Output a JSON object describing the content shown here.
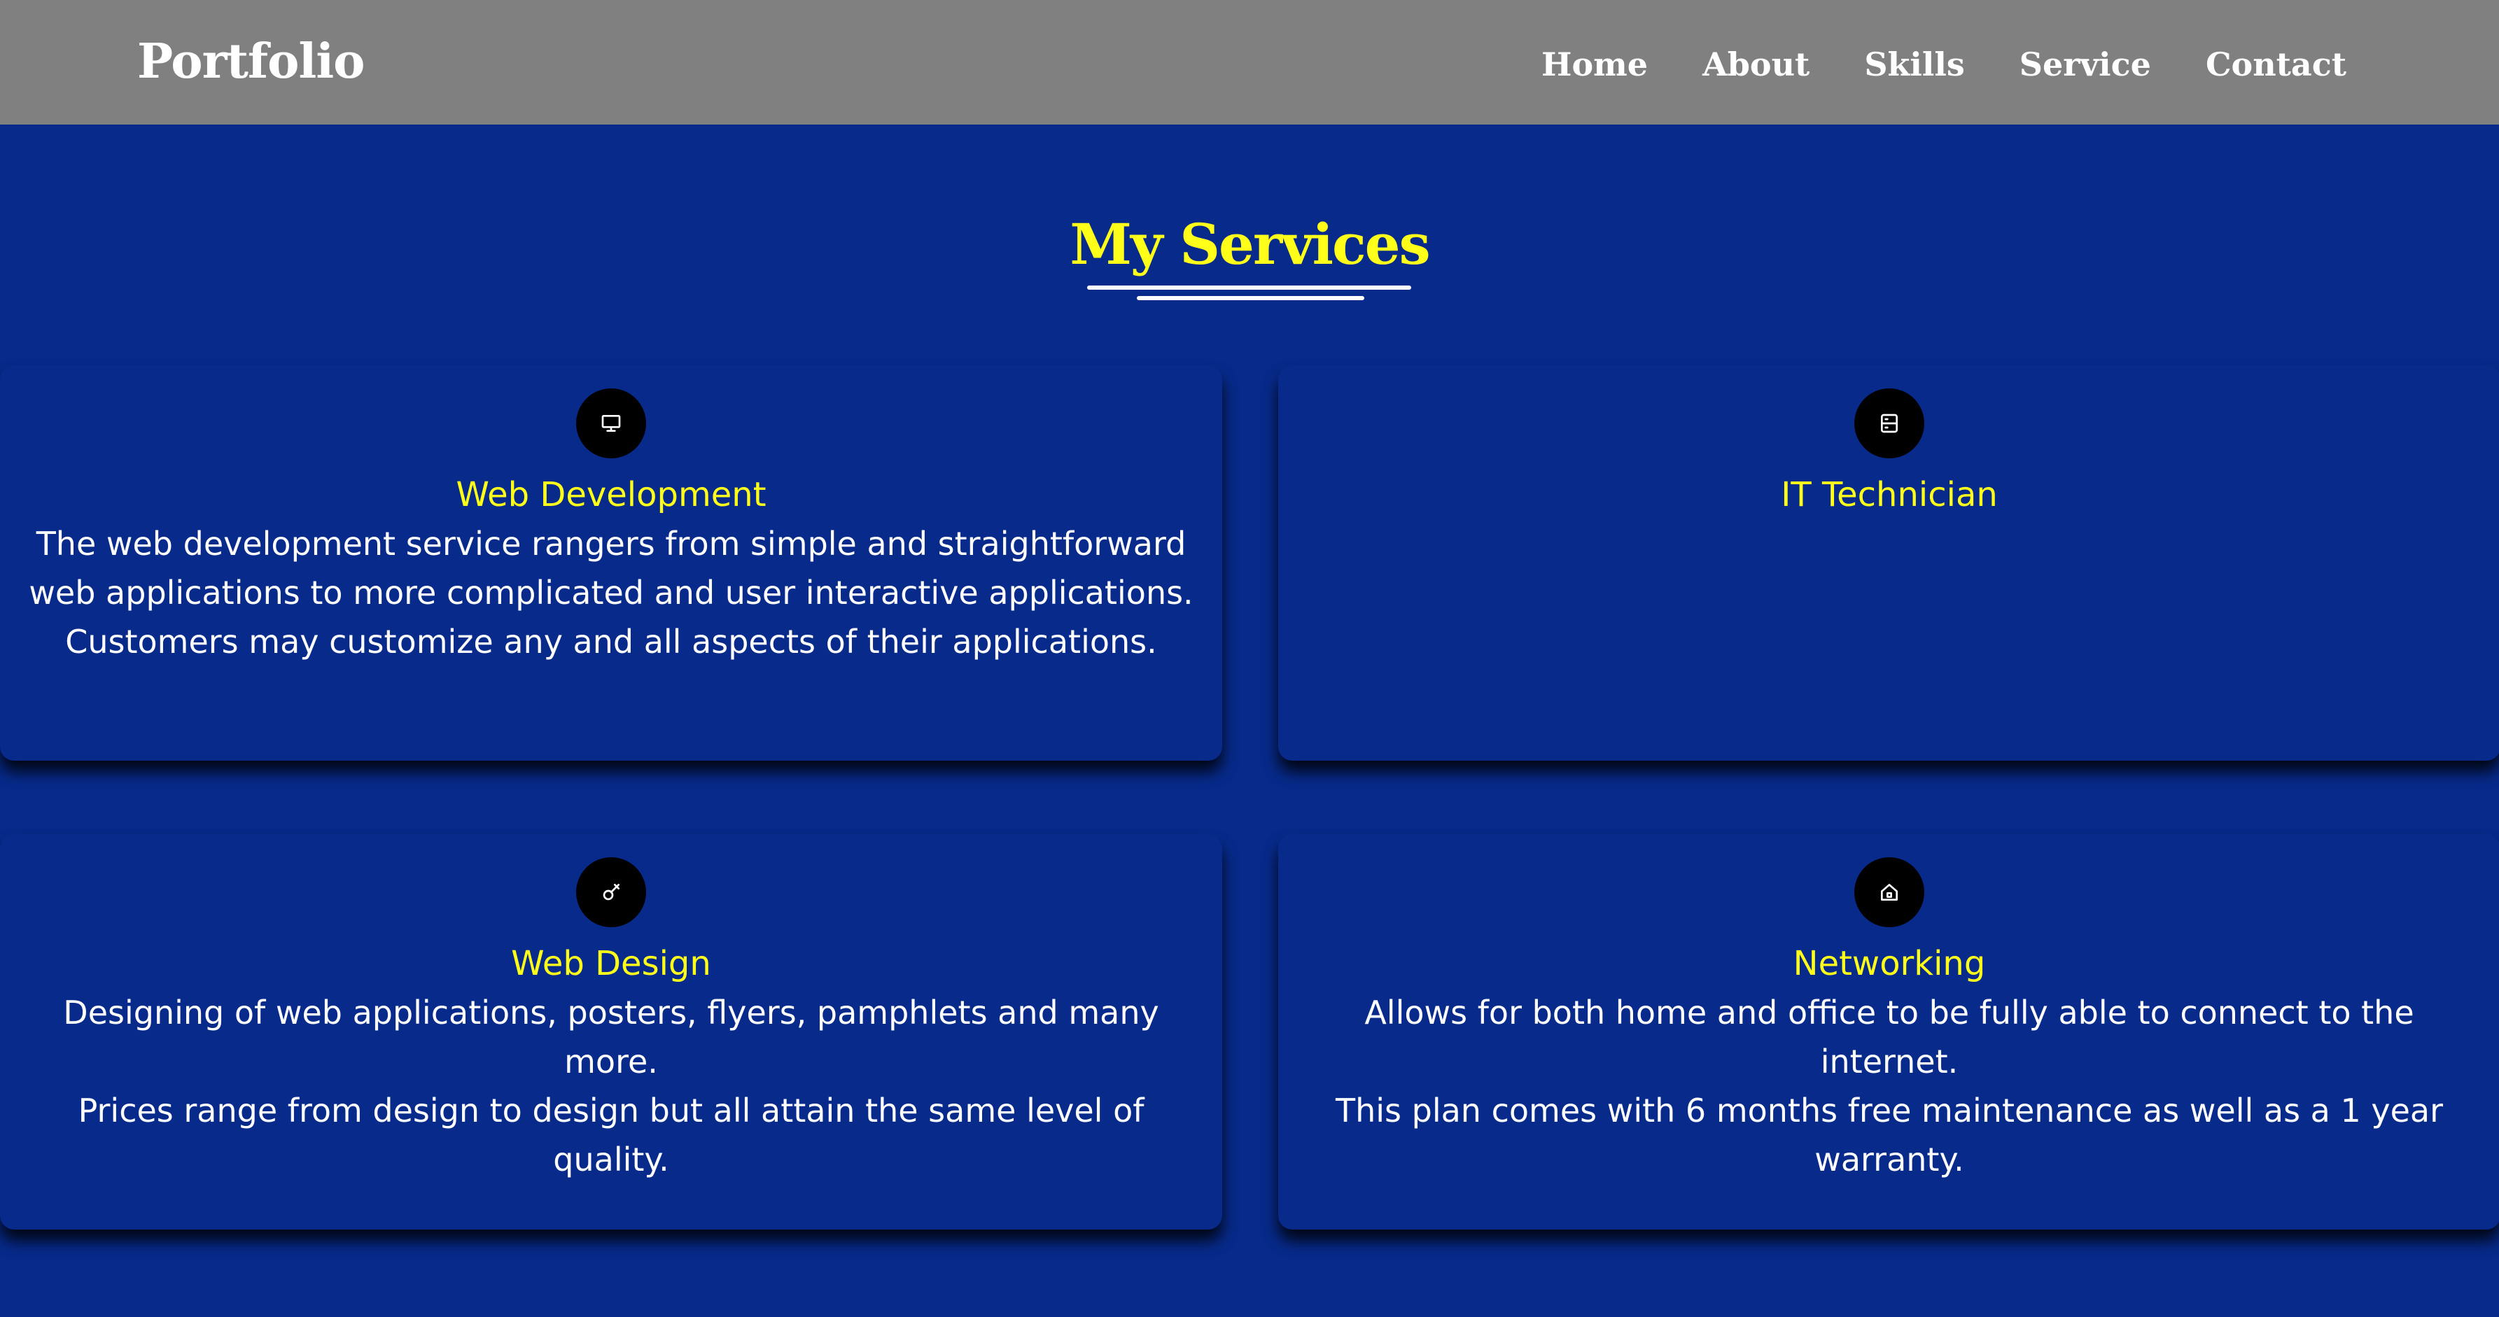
{
  "navbar": {
    "brand": "Portfolio",
    "links": [
      "Home",
      "About",
      "Skills",
      "Service",
      "Contact"
    ]
  },
  "section": {
    "title": "My Services"
  },
  "services": [
    {
      "icon": "monitor-icon",
      "title": "Web Development",
      "paragraphs": [
        "The web development service rangers from simple and straightforward web applications to more complicated and user interactive applications.",
        "Customers may customize any and all aspects of their applications."
      ]
    },
    {
      "icon": "server-icon",
      "title": "IT Technician",
      "paragraphs": []
    },
    {
      "icon": "paint-brush-icon",
      "title": "Web Design",
      "paragraphs": [
        "Designing of web applications, posters, flyers, pamphlets and many more.",
        "Prices range from design to design but all attain the same level of quality."
      ]
    },
    {
      "icon": "home-icon",
      "title": "Networking",
      "paragraphs": [
        "Allows for both home and office to be fully able to connect to the internet.",
        "This plan comes with 6 months free maintenance as well as a 1 year warranty."
      ]
    }
  ],
  "colors": {
    "background": "#072a8b",
    "navbar": "#808080",
    "accent": "#ffff1a",
    "text": "#ffffff",
    "icon_bg": "#000000"
  }
}
